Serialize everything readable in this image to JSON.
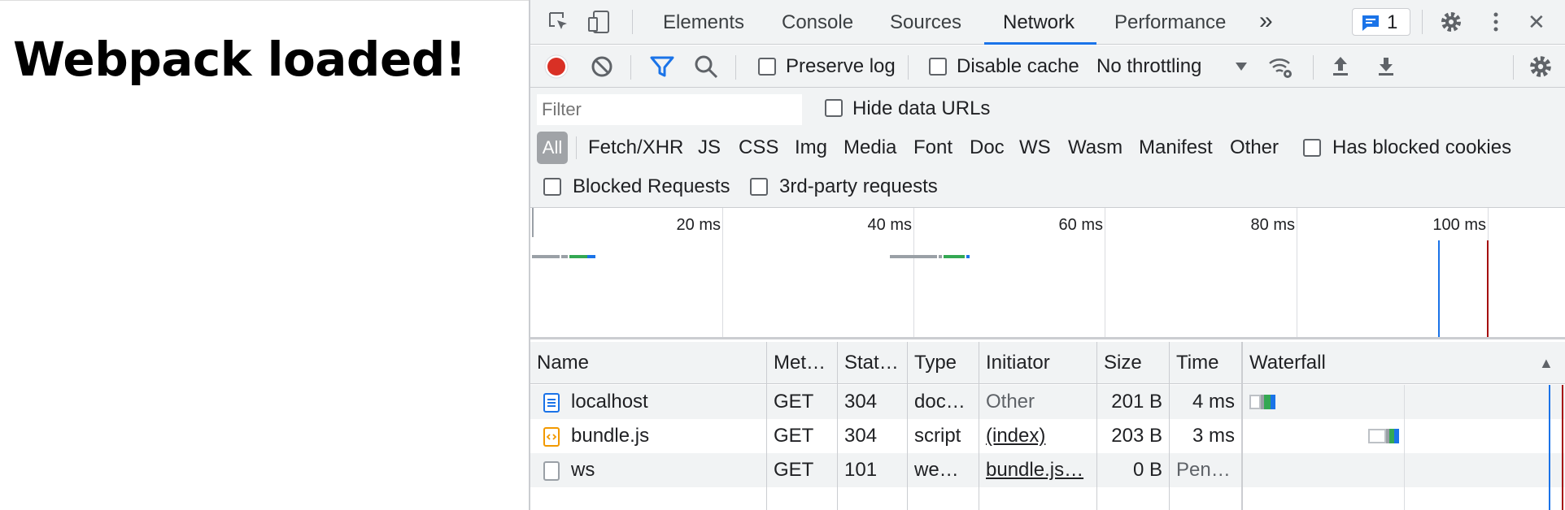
{
  "page": {
    "heading": "Webpack loaded!"
  },
  "tabs": [
    "Elements",
    "Console",
    "Sources",
    "Network",
    "Performance"
  ],
  "tabbar": {
    "more": "»",
    "issues_count": "1",
    "close": "✕"
  },
  "toolbar": {
    "preserve_log": "Preserve log",
    "disable_cache": "Disable cache",
    "throttling": "No throttling"
  },
  "filter": {
    "placeholder": "Filter",
    "hide_data_urls": "Hide data URLs",
    "types": [
      "All",
      "Fetch/XHR",
      "JS",
      "CSS",
      "Img",
      "Media",
      "Font",
      "Doc",
      "WS",
      "Wasm",
      "Manifest",
      "Other"
    ],
    "has_blocked_cookies": "Has blocked cookies",
    "blocked_requests": "Blocked Requests",
    "third_party": "3rd-party requests"
  },
  "overview": {
    "ticks": [
      "20 ms",
      "40 ms",
      "60 ms",
      "80 ms",
      "100 ms"
    ]
  },
  "table": {
    "columns": [
      "Name",
      "Met…",
      "Stat…",
      "Type",
      "Initiator",
      "Size",
      "Time",
      "Waterfall"
    ],
    "sort_indicator": "▲",
    "rows": [
      {
        "name": "localhost",
        "method": "GET",
        "status": "304",
        "type": "doc…",
        "initiator": "Other",
        "size": "201 B",
        "time": "4 ms",
        "icon": "document-icon"
      },
      {
        "name": "bundle.js",
        "method": "GET",
        "status": "304",
        "type": "script",
        "initiator": "(index)",
        "size": "203 B",
        "time": "3 ms",
        "icon": "script-icon"
      },
      {
        "name": "ws",
        "method": "GET",
        "status": "101",
        "type": "we…",
        "initiator": "bundle.js…",
        "size": "0 B",
        "time": "Pen…",
        "icon": "websocket-icon"
      }
    ]
  },
  "colors": {
    "accent": "#1a73e8",
    "record": "#d93025",
    "connect": "#34a853",
    "download": "#1a73e8",
    "load_marker": "#a50e0e"
  }
}
